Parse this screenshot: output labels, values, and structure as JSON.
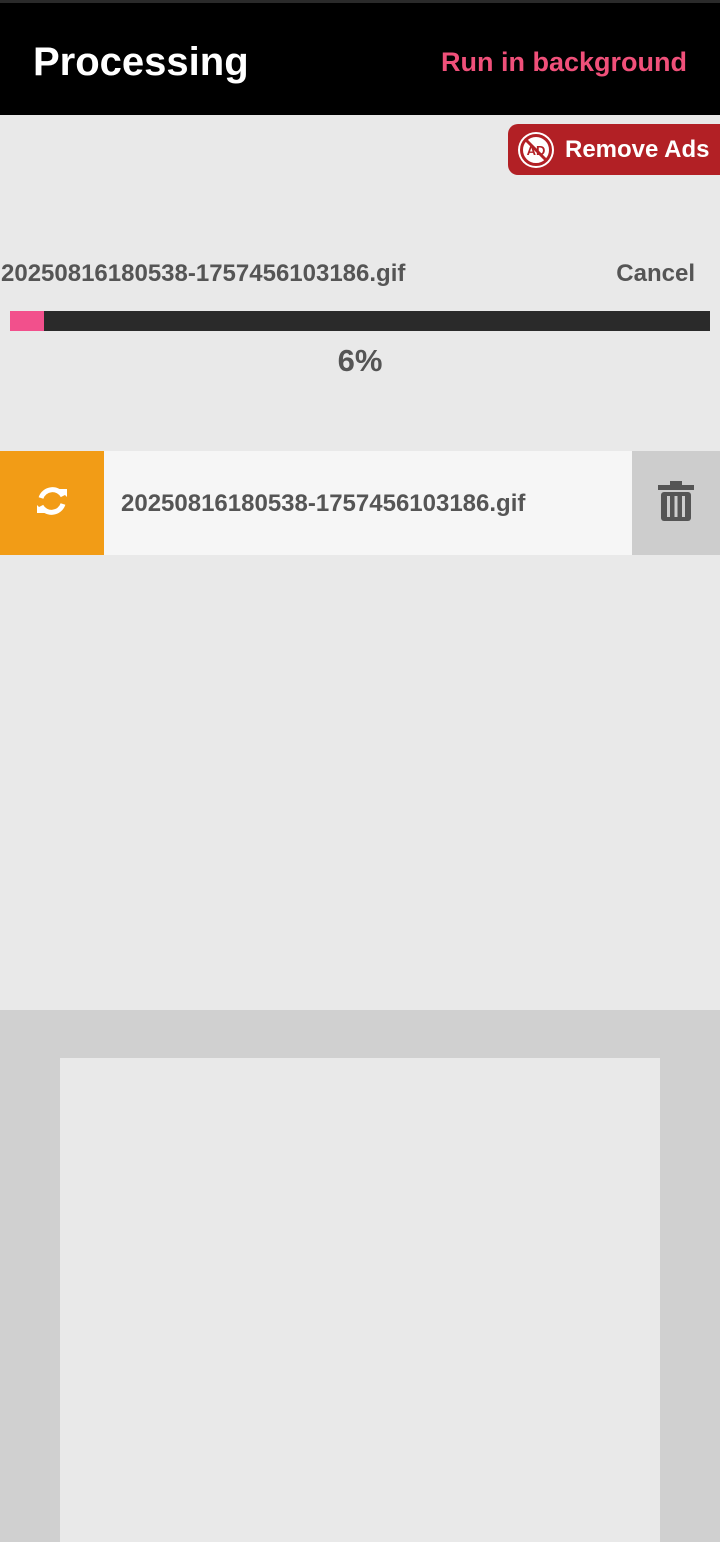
{
  "header": {
    "title": "Processing",
    "run_in_background": "Run in background"
  },
  "remove_ads": {
    "label": "Remove Ads",
    "icon": "no-ads-icon",
    "icon_text": "AD"
  },
  "progress": {
    "file_name": "20250816180538-1757456103186.gif",
    "cancel_label": "Cancel",
    "percent_label": "6%",
    "value": 0.048
  },
  "file_list": [
    {
      "name": "20250816180538-1757456103186.gif",
      "status_icon": "refresh-icon",
      "delete_icon": "trash-icon"
    }
  ],
  "colors": {
    "header_bg": "#000000",
    "accent_pink": "#f0507a",
    "remove_ads_bg": "#b22025",
    "status_orange": "#f29c16",
    "progress_fill": "#f2508c",
    "progress_track": "#2a2a2a"
  }
}
